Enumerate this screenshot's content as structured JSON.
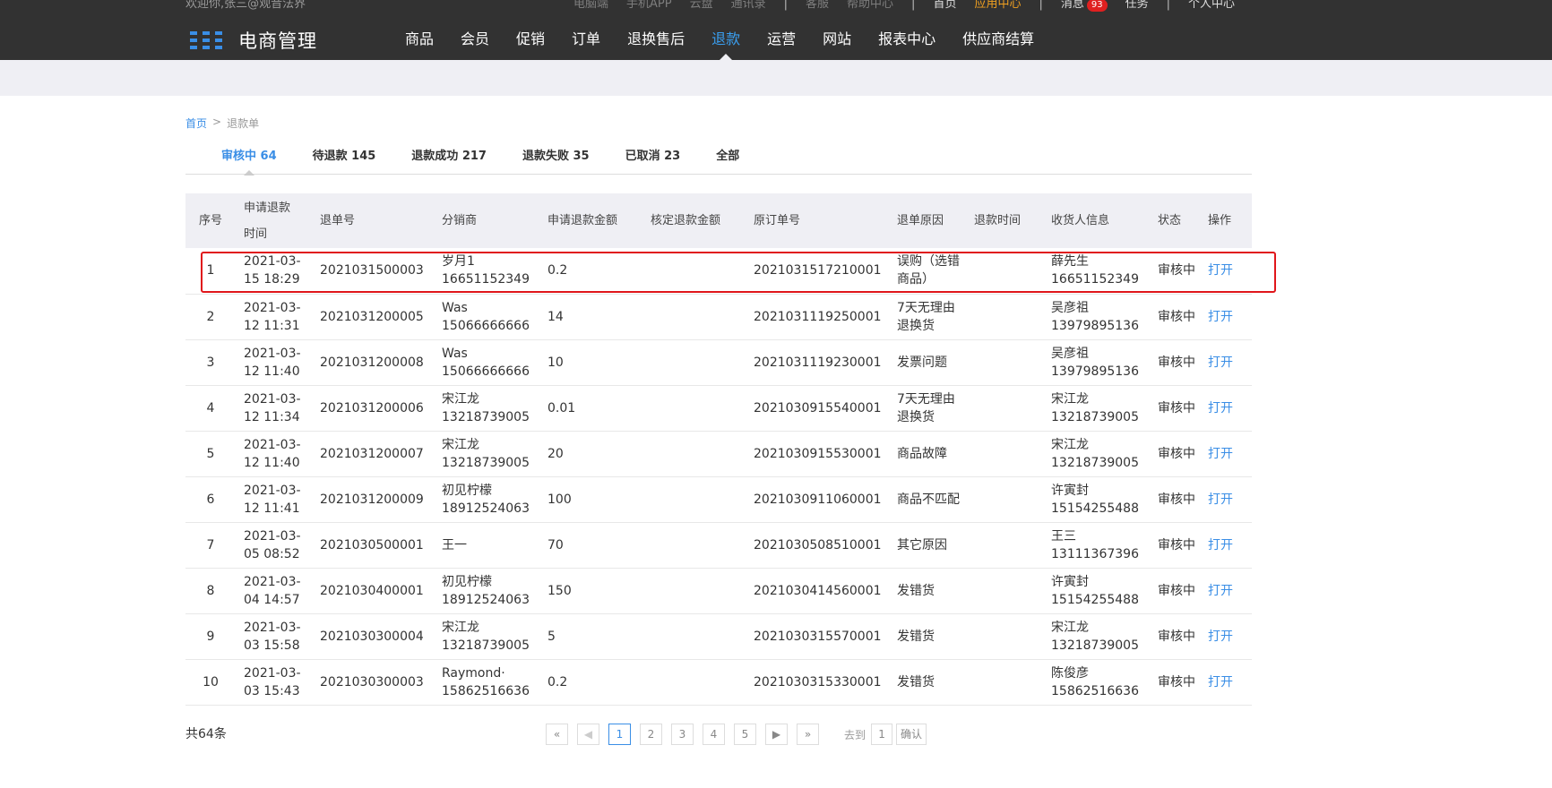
{
  "header": {
    "welcome": "欢迎你,张三@观音法界",
    "toplinks": {
      "pc": "电脑端",
      "app": "手机APP",
      "cloud": "云盘",
      "contacts": "通讯录",
      "service": "客服",
      "help": "帮助中心",
      "home": "首页",
      "app_center": "应用中心",
      "messages": "消息",
      "messages_count": "93",
      "tasks": "任务",
      "profile": "个人中心"
    },
    "logo_text": "电商管理",
    "nav": [
      {
        "label": "商品"
      },
      {
        "label": "会员"
      },
      {
        "label": "促销"
      },
      {
        "label": "订单"
      },
      {
        "label": "退换售后"
      },
      {
        "label": "退款"
      },
      {
        "label": "运营"
      },
      {
        "label": "网站"
      },
      {
        "label": "报表中心"
      },
      {
        "label": "供应商结算"
      }
    ],
    "accent_color": "#3a9ff0"
  },
  "breadcrumb": {
    "home": "首页",
    "separator": ">",
    "current": "退款单"
  },
  "tabs": [
    {
      "label": "审核中 64"
    },
    {
      "label": "待退款 145"
    },
    {
      "label": "退款成功 217"
    },
    {
      "label": "退款失败 35"
    },
    {
      "label": "已取消 23"
    },
    {
      "label": "全部"
    }
  ],
  "table": {
    "headers": {
      "seq": "序号",
      "apply_time_1": "申请退款",
      "apply_time_2": "时间",
      "refund_no": "退单号",
      "distributor": "分销商",
      "apply_amount": "申请退款金额",
      "approved_amount": "核定退款金额",
      "order_no": "原订单号",
      "reason": "退单原因",
      "refund_time": "退款时间",
      "receiver": "收货人信息",
      "status": "状态",
      "action": "操作"
    },
    "rows": [
      {
        "seq": "1",
        "date": "2021-03-",
        "time": "15 18:29",
        "refund_no": "2021031500003",
        "dist_name": "岁月1",
        "dist_phone": "16651152349",
        "amount": "0.2",
        "approved": "",
        "order_no": "2021031517210001",
        "reason": "误购（选错商品）",
        "refund_time": "",
        "recv_name": "薛先生",
        "recv_phone": "16651152349",
        "status": "审核中",
        "action": "打开"
      },
      {
        "seq": "2",
        "date": "2021-03-",
        "time": "12 11:31",
        "refund_no": "2021031200005",
        "dist_name": "Was",
        "dist_phone": "15066666666",
        "amount": "14",
        "approved": "",
        "order_no": "2021031119250001",
        "reason": "7天无理由退换货",
        "refund_time": "",
        "recv_name": "吴彦祖",
        "recv_phone": "13979895136",
        "status": "审核中",
        "action": "打开"
      },
      {
        "seq": "3",
        "date": "2021-03-",
        "time": "12 11:40",
        "refund_no": "2021031200008",
        "dist_name": "Was",
        "dist_phone": "15066666666",
        "amount": "10",
        "approved": "",
        "order_no": "2021031119230001",
        "reason": "发票问题",
        "refund_time": "",
        "recv_name": "吴彦祖",
        "recv_phone": "13979895136",
        "status": "审核中",
        "action": "打开"
      },
      {
        "seq": "4",
        "date": "2021-03-",
        "time": "12 11:34",
        "refund_no": "2021031200006",
        "dist_name": "宋江龙",
        "dist_phone": "13218739005",
        "amount": "0.01",
        "approved": "",
        "order_no": "2021030915540001",
        "reason": "7天无理由退换货",
        "refund_time": "",
        "recv_name": "宋江龙",
        "recv_phone": "13218739005",
        "status": "审核中",
        "action": "打开"
      },
      {
        "seq": "5",
        "date": "2021-03-",
        "time": "12 11:40",
        "refund_no": "2021031200007",
        "dist_name": "宋江龙",
        "dist_phone": "13218739005",
        "amount": "20",
        "approved": "",
        "order_no": "2021030915530001",
        "reason": "商品故障",
        "refund_time": "",
        "recv_name": "宋江龙",
        "recv_phone": "13218739005",
        "status": "审核中",
        "action": "打开"
      },
      {
        "seq": "6",
        "date": "2021-03-",
        "time": "12 11:41",
        "refund_no": "2021031200009",
        "dist_name": "初见柠檬",
        "dist_phone": "18912524063",
        "amount": "100",
        "approved": "",
        "order_no": "2021030911060001",
        "reason": "商品不匹配",
        "refund_time": "",
        "recv_name": "许寅封",
        "recv_phone": "15154255488",
        "status": "审核中",
        "action": "打开"
      },
      {
        "seq": "7",
        "date": "2021-03-",
        "time": "05 08:52",
        "refund_no": "2021030500001",
        "dist_name": "王一",
        "dist_phone": "",
        "amount": "70",
        "approved": "",
        "order_no": "2021030508510001",
        "reason": "其它原因",
        "refund_time": "",
        "recv_name": "王三",
        "recv_phone": "13111367396",
        "status": "审核中",
        "action": "打开"
      },
      {
        "seq": "8",
        "date": "2021-03-",
        "time": "04 14:57",
        "refund_no": "2021030400001",
        "dist_name": "初见柠檬",
        "dist_phone": "18912524063",
        "amount": "150",
        "approved": "",
        "order_no": "2021030414560001",
        "reason": "发错货",
        "refund_time": "",
        "recv_name": "许寅封",
        "recv_phone": "15154255488",
        "status": "审核中",
        "action": "打开"
      },
      {
        "seq": "9",
        "date": "2021-03-",
        "time": "03 15:58",
        "refund_no": "2021030300004",
        "dist_name": "宋江龙",
        "dist_phone": "13218739005",
        "amount": "5",
        "approved": "",
        "order_no": "2021030315570001",
        "reason": "发错货",
        "refund_time": "",
        "recv_name": "宋江龙",
        "recv_phone": "13218739005",
        "status": "审核中",
        "action": "打开"
      },
      {
        "seq": "10",
        "date": "2021-03-",
        "time": "03 15:43",
        "refund_no": "2021030300003",
        "dist_name": "Raymond·",
        "dist_phone": "15862516636",
        "amount": "0.2",
        "approved": "",
        "order_no": "2021030315330001",
        "reason": "发错货",
        "refund_time": "",
        "recv_name": "陈俊彦",
        "recv_phone": "15862516636",
        "status": "审核中",
        "action": "打开"
      }
    ]
  },
  "footer": {
    "total": "共64条",
    "pager": {
      "first": "«",
      "prev": "◀",
      "pages": [
        "1",
        "2",
        "3",
        "4",
        "5"
      ],
      "next": "▶",
      "last": "»",
      "goto_label": "去到",
      "goto_value": "1",
      "confirm": "确认"
    }
  },
  "highlight_color": "#e0161b"
}
